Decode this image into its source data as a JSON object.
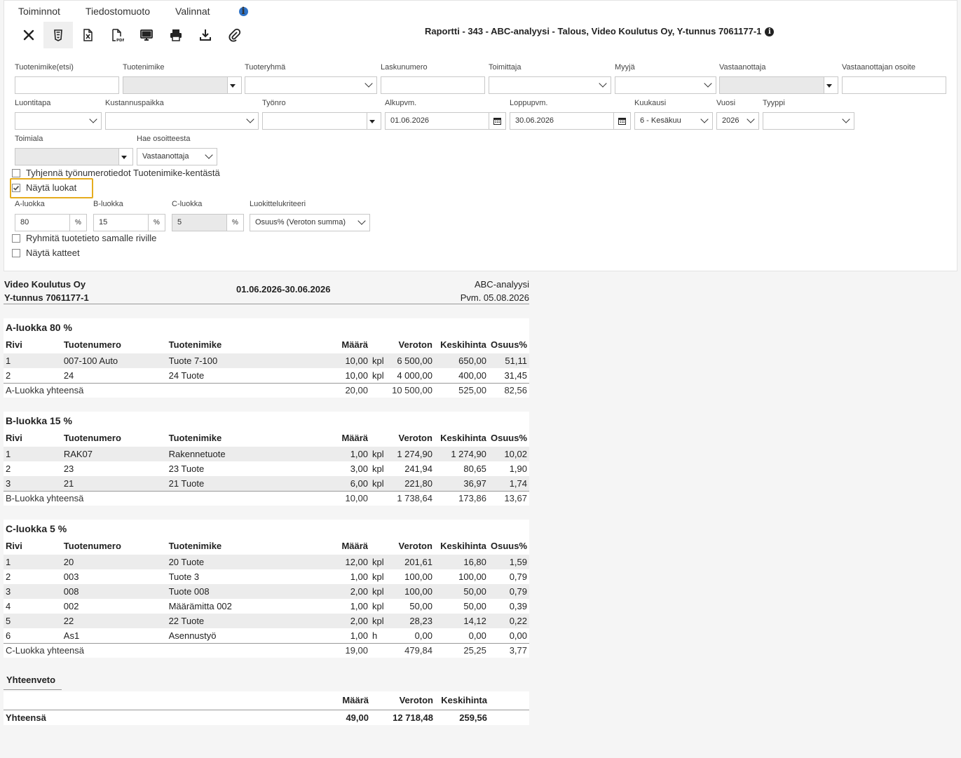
{
  "menu": {
    "toiminnot": "Toiminnot",
    "tiedostomuoto": "Tiedostomuoto",
    "valinnat": "Valinnat"
  },
  "toolbar": [
    "close-icon",
    "html-icon",
    "excel-icon",
    "pdf-icon",
    "screen-icon",
    "print-icon",
    "download-icon",
    "attachment-icon"
  ],
  "report_title": "Raportti - 343 - ABC-analyysi - Talous, Video Koulutus Oy, Y-tunnus 7061177-1",
  "filters": {
    "tuotenimike_etsi": {
      "label": "Tuotenimike(etsi)",
      "value": ""
    },
    "tuotenimike": {
      "label": "Tuotenimike",
      "value": ""
    },
    "tuoteryhma": {
      "label": "Tuoteryhmä",
      "value": ""
    },
    "laskunumero": {
      "label": "Laskunumero",
      "value": ""
    },
    "toimittaja": {
      "label": "Toimittaja",
      "value": ""
    },
    "myyja": {
      "label": "Myyjä",
      "value": ""
    },
    "vastaanottaja": {
      "label": "Vastaanottaja",
      "value": ""
    },
    "vastaanottajan_osoite": {
      "label": "Vastaanottajan osoite",
      "value": ""
    },
    "luontitapa": {
      "label": "Luontitapa",
      "value": ""
    },
    "kustannuspaikka": {
      "label": "Kustannuspaikka",
      "value": ""
    },
    "tyonro": {
      "label": "Työnro",
      "value": ""
    },
    "alkupvm": {
      "label": "Alkupvm.",
      "value": "01.06.2026"
    },
    "loppupvm": {
      "label": "Loppupvm.",
      "value": "30.06.2026"
    },
    "kuukausi": {
      "label": "Kuukausi",
      "value": "6 - Kesäkuu"
    },
    "vuosi": {
      "label": "Vuosi",
      "value": "2026"
    },
    "tyyppi": {
      "label": "Tyyppi",
      "value": ""
    },
    "toimiala": {
      "label": "Toimiala",
      "value": ""
    },
    "hae_osoitteesta": {
      "label": "Hae osoitteesta",
      "value": "Vastaanottaja"
    },
    "tyhjenna": {
      "label": "Tyhjennä työnumerotiedot Tuotenimike-kentästä",
      "checked": false
    },
    "nayta_luokat": {
      "label": "Näytä luokat",
      "checked": true
    },
    "a_luokka": {
      "label": "A-luokka",
      "value": "80",
      "unit": "%"
    },
    "b_luokka": {
      "label": "B-luokka",
      "value": "15",
      "unit": "%"
    },
    "c_luokka": {
      "label": "C-luokka",
      "value": "5",
      "unit": "%"
    },
    "luokittelukriteeri": {
      "label": "Luokittelukriteeri",
      "value": "Osuus% (Veroton summa)"
    },
    "ryhmita": {
      "label": "Ryhmitä tuotetieto samalle riville",
      "checked": false
    },
    "nayta_katteet": {
      "label": "Näytä katteet",
      "checked": false
    }
  },
  "report": {
    "company": "Video Koulutus Oy",
    "business_id": "Y-tunnus 7061177-1",
    "period": "01.06.2026-30.06.2026",
    "report_name": "ABC-analyysi",
    "date": "Pvm. 05.08.2026",
    "columns": [
      "Rivi",
      "Tuotenumero",
      "Tuotenimike",
      "Määrä",
      "Veroton",
      "Keskihinta",
      "Osuus%"
    ],
    "sections": [
      {
        "title": "A-luokka 80 %",
        "rows": [
          [
            "1",
            "007-100 Auto",
            "Tuote 7-100",
            "10,00",
            "kpl",
            "6 500,00",
            "650,00",
            "51,11"
          ],
          [
            "2",
            "24",
            "24 Tuote",
            "10,00",
            "kpl",
            "4 000,00",
            "400,00",
            "31,45"
          ]
        ],
        "total": [
          "A-Luokka yhteensä",
          "20,00",
          "10 500,00",
          "525,00",
          "82,56"
        ]
      },
      {
        "title": "B-luokka 15 %",
        "rows": [
          [
            "1",
            "RAK07",
            "Rakennetuote",
            "1,00",
            "kpl",
            "1 274,90",
            "1 274,90",
            "10,02"
          ],
          [
            "2",
            "23",
            "23 Tuote",
            "3,00",
            "kpl",
            "241,94",
            "80,65",
            "1,90"
          ],
          [
            "3",
            "21",
            "21 Tuote",
            "6,00",
            "kpl",
            "221,80",
            "36,97",
            "1,74"
          ]
        ],
        "total": [
          "B-Luokka yhteensä",
          "10,00",
          "1 738,64",
          "173,86",
          "13,67"
        ]
      },
      {
        "title": "C-luokka 5 %",
        "rows": [
          [
            "1",
            "20",
            "20 Tuote",
            "12,00",
            "kpl",
            "201,61",
            "16,80",
            "1,59"
          ],
          [
            "2",
            "003",
            "Tuote 3",
            "1,00",
            "kpl",
            "100,00",
            "100,00",
            "0,79"
          ],
          [
            "3",
            "008",
            "Tuote 008",
            "2,00",
            "kpl",
            "100,00",
            "50,00",
            "0,79"
          ],
          [
            "4",
            "002",
            "Määrämitta 002",
            "1,00",
            "kpl",
            "50,00",
            "50,00",
            "0,39"
          ],
          [
            "5",
            "22",
            "22 Tuote",
            "2,00",
            "kpl",
            "28,23",
            "14,12",
            "0,22"
          ],
          [
            "6",
            "As1",
            "Asennustyö",
            "1,00",
            "h",
            "0,00",
            "0,00",
            "0,00"
          ]
        ],
        "total": [
          "C-Luokka yhteensä",
          "19,00",
          "479,84",
          "25,25",
          "3,77"
        ]
      }
    ],
    "summary": {
      "title": "Yhteenveto",
      "columns": [
        "Määrä",
        "Veroton",
        "Keskihinta"
      ],
      "label": "Yhteensä",
      "values": [
        "49,00",
        "12 718,48",
        "259,56"
      ]
    }
  }
}
